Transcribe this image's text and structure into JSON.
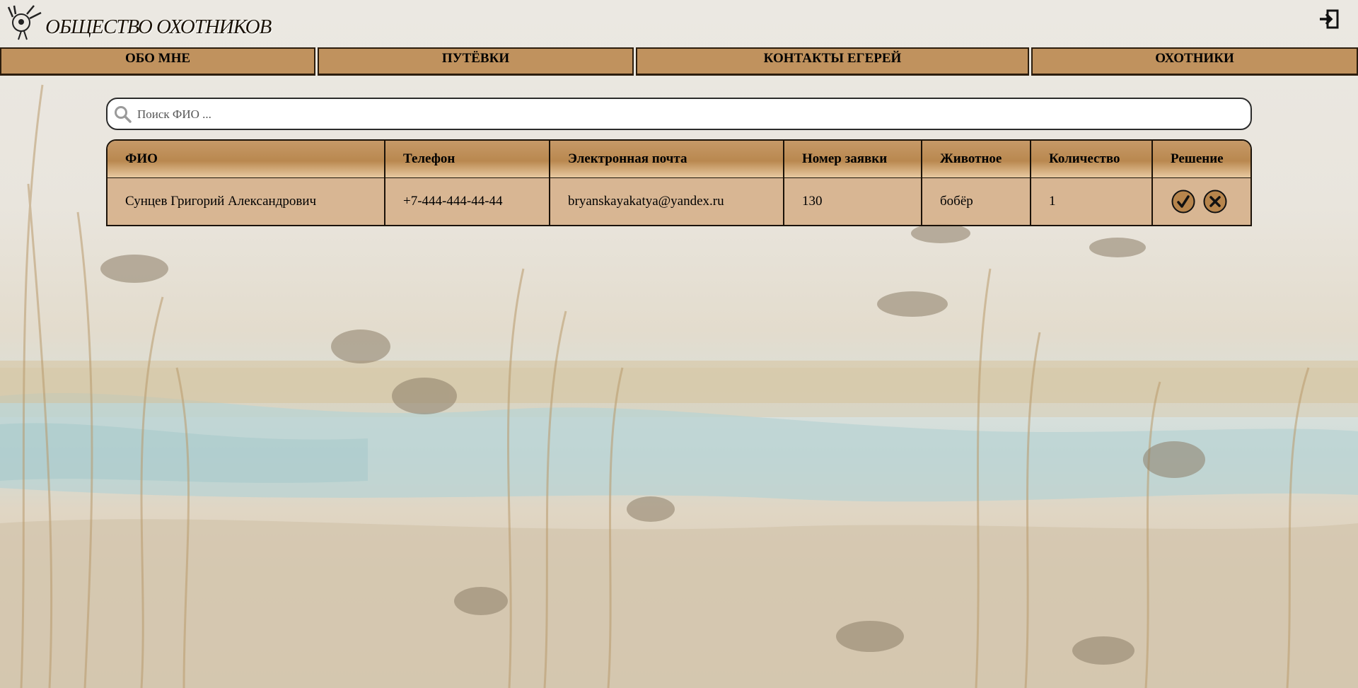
{
  "header": {
    "site_title": "ОБЩЕСТВО ОХОТНИКОВ",
    "logo_icon": "hunter-logo-icon",
    "logout_icon": "logout-icon"
  },
  "nav": {
    "items": [
      {
        "label": "ОБО МНЕ"
      },
      {
        "label": "ПУТЁВКИ"
      },
      {
        "label": "КОНТАКТЫ ЕГЕРЕЙ"
      },
      {
        "label": "ОХОТНИКИ"
      }
    ]
  },
  "search": {
    "placeholder": "Поиск ФИО ...",
    "value": "",
    "icon": "search-icon"
  },
  "table": {
    "columns": [
      "ФИО",
      "Телефон",
      "Электронная почта",
      "Номер заявки",
      "Животное",
      "Количество",
      "Решение"
    ],
    "rows": [
      {
        "fio": "Сунцев Григорий Александрович",
        "phone": "+7-444-444-44-44",
        "email": "bryanskayakatya@yandex.ru",
        "request_number": "130",
        "animal": "бобёр",
        "quantity": "1",
        "actions": [
          "approve-icon",
          "reject-icon"
        ]
      }
    ]
  },
  "colors": {
    "accent": "#c0925e",
    "border": "#1b1208",
    "row_bg": "#d6b28c",
    "button_fill": "#b7854c"
  }
}
